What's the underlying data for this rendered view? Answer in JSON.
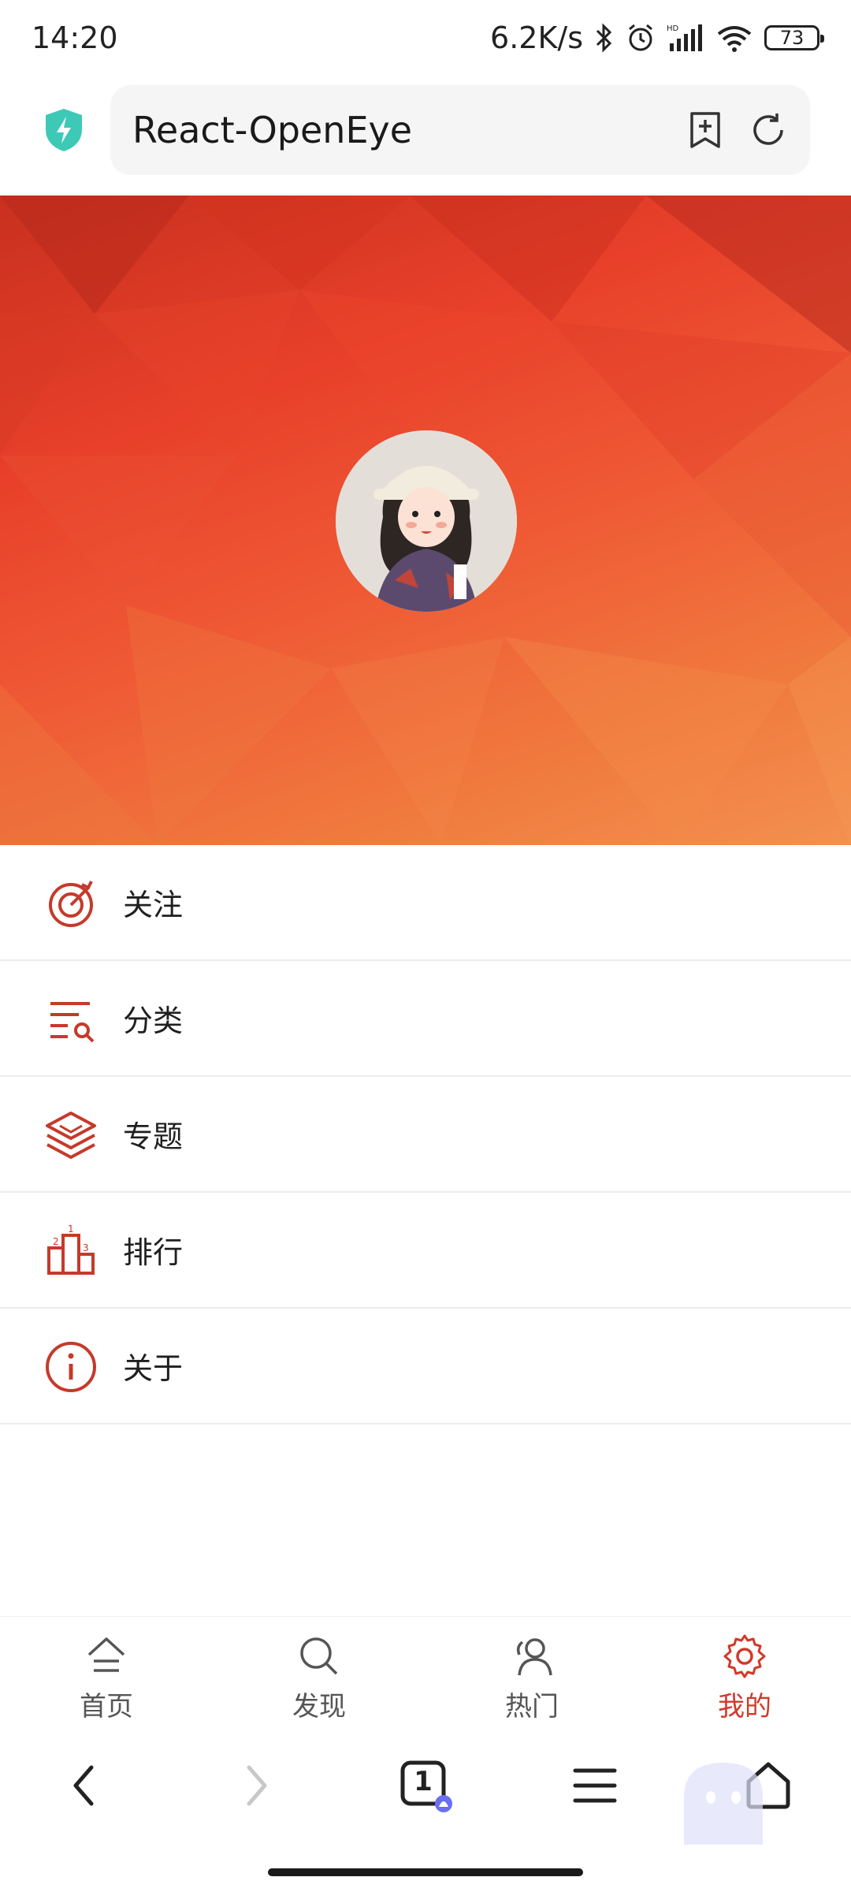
{
  "status": {
    "time": "14:20",
    "net_speed": "6.2K/s",
    "battery": "73"
  },
  "browser": {
    "url_title": "React-OpenEye",
    "tab_count": "1"
  },
  "menu": [
    {
      "label": "关注",
      "icon": "target-icon"
    },
    {
      "label": "分类",
      "icon": "list-search-icon"
    },
    {
      "label": "专题",
      "icon": "layers-icon"
    },
    {
      "label": "排行",
      "icon": "podium-icon"
    },
    {
      "label": "关于",
      "icon": "info-icon"
    }
  ],
  "tabs": [
    {
      "label": "首页",
      "icon": "home-icon",
      "active": false
    },
    {
      "label": "发现",
      "icon": "search-icon",
      "active": false
    },
    {
      "label": "热门",
      "icon": "users-icon",
      "active": false
    },
    {
      "label": "我的",
      "icon": "gear-icon",
      "active": true
    }
  ],
  "colors": {
    "accent": "#d03a2a",
    "hero_top": "#c8301f",
    "hero_bottom": "#f39050"
  }
}
